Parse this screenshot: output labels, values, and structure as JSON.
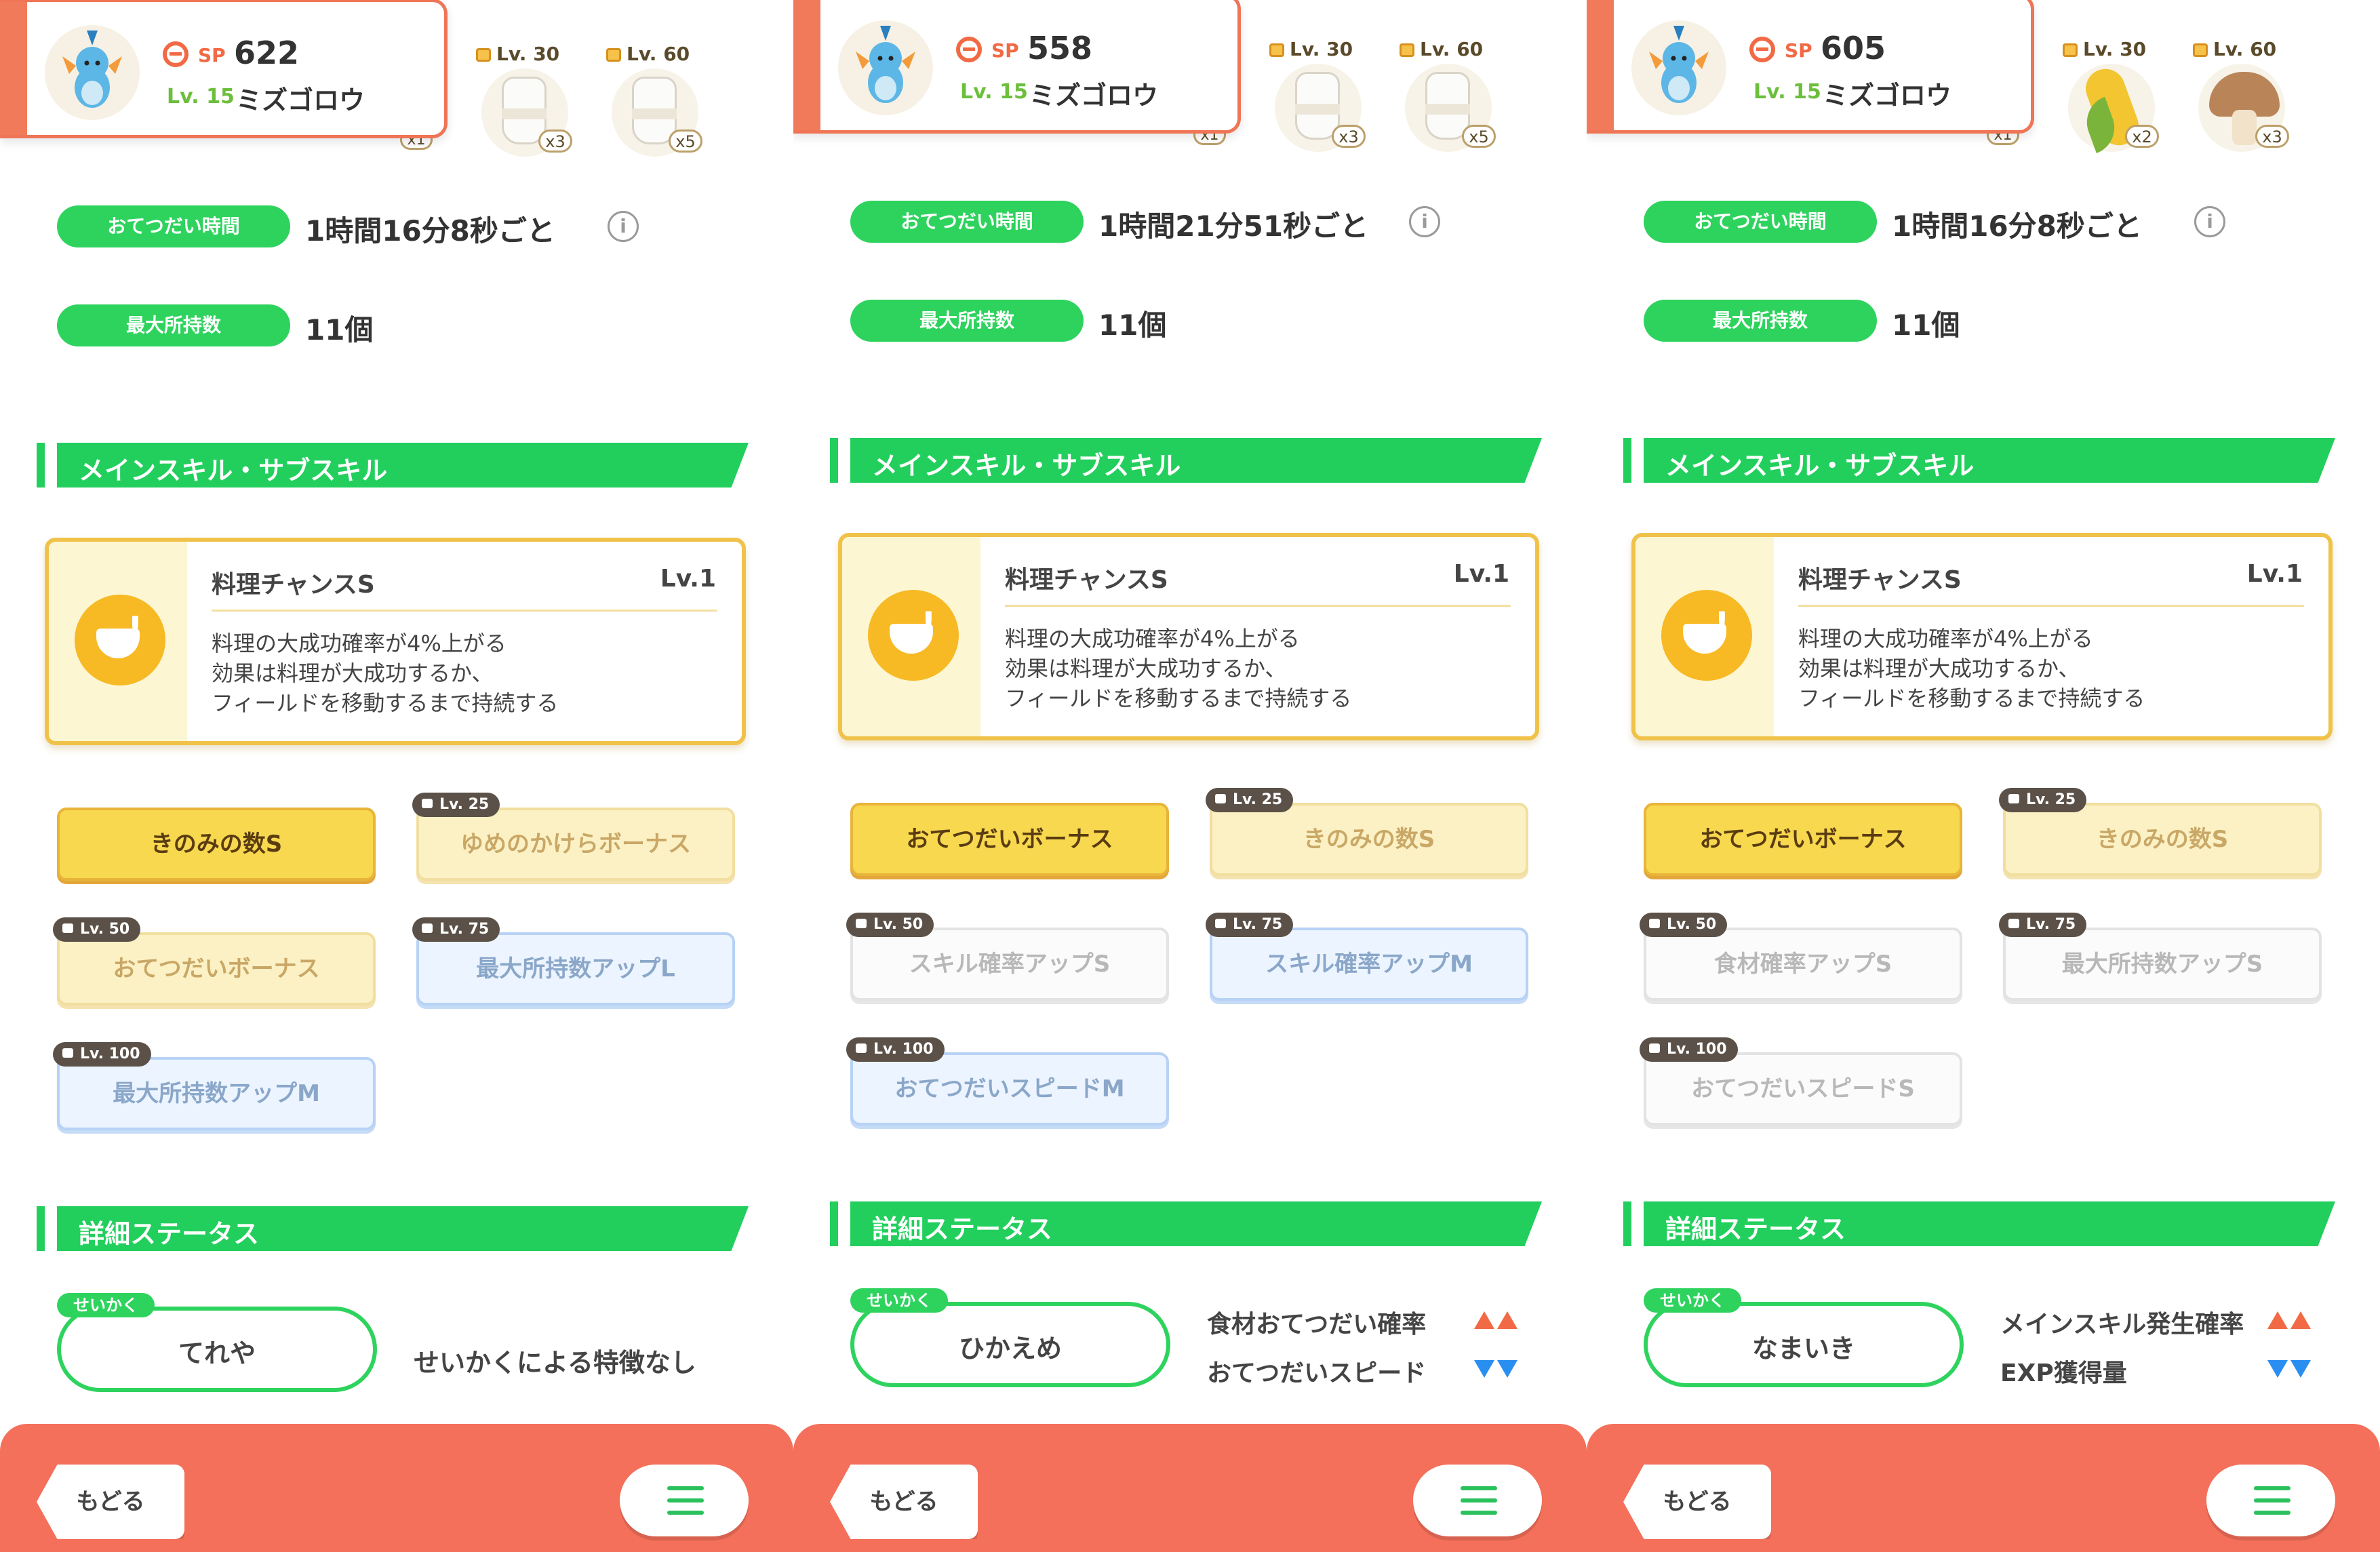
{
  "panels": [
    {
      "header": {
        "sp_label": "SP",
        "sp": "622",
        "level": "Lv. 15",
        "name": "ミズゴロウ",
        "ingredients": [
          {
            "lock": "Lv. 30",
            "count": "x3",
            "kind": "milk"
          },
          {
            "lock": "Lv. 60",
            "count": "x5",
            "kind": "milk"
          }
        ],
        "partial_count": "x1"
      },
      "help_label": "おてつだい時間",
      "help_value": "1時間16分8秒ごと",
      "max_label": "最大所持数",
      "max_value": "11個",
      "skills_section": "メインスキル・サブスキル",
      "main_skill": {
        "name": "料理チャンスS",
        "level": "Lv.1",
        "desc": "料理の大成功確率が4%上がる\n効果は料理が大成功するか、\nフィールドを移動するまで持続する"
      },
      "sub_skills": [
        {
          "label": "きのみの数S",
          "lock": "",
          "style": "gold"
        },
        {
          "label": "ゆめのかけらボーナス",
          "lock": "Lv. 25",
          "style": "gold-dim"
        },
        {
          "label": "おてつだいボーナス",
          "lock": "Lv. 50",
          "style": "gold-dim"
        },
        {
          "label": "最大所持数アップL",
          "lock": "Lv. 75",
          "style": "blue-dim"
        },
        {
          "label": "最大所持数アップM",
          "lock": "Lv. 100",
          "style": "blue-dim"
        }
      ],
      "details_section": "詳細ステータス",
      "nature_tag": "せいかく",
      "nature": "てれや",
      "nature_none": "せいかくによる特徴なし",
      "effects": [],
      "back": "もどる"
    },
    {
      "header": {
        "sp_label": "SP",
        "sp": "558",
        "level": "Lv. 15",
        "name": "ミズゴロウ",
        "ingredients": [
          {
            "lock": "Lv. 30",
            "count": "x3",
            "kind": "milk"
          },
          {
            "lock": "Lv. 60",
            "count": "x5",
            "kind": "milk"
          }
        ],
        "partial_count": "x1"
      },
      "help_label": "おてつだい時間",
      "help_value": "1時間21分51秒ごと",
      "max_label": "最大所持数",
      "max_value": "11個",
      "skills_section": "メインスキル・サブスキル",
      "main_skill": {
        "name": "料理チャンスS",
        "level": "Lv.1",
        "desc": "料理の大成功確率が4%上がる\n効果は料理が大成功するか、\nフィールドを移動するまで持続する"
      },
      "sub_skills": [
        {
          "label": "おてつだいボーナス",
          "lock": "",
          "style": "gold"
        },
        {
          "label": "きのみの数S",
          "lock": "Lv. 25",
          "style": "gold-dim"
        },
        {
          "label": "スキル確率アップS",
          "lock": "Lv. 50",
          "style": "white-dim"
        },
        {
          "label": "スキル確率アップM",
          "lock": "Lv. 75",
          "style": "blue-dim"
        },
        {
          "label": "おてつだいスピードM",
          "lock": "Lv. 100",
          "style": "blue-dim"
        }
      ],
      "details_section": "詳細ステータス",
      "nature_tag": "せいかく",
      "nature": "ひかえめ",
      "nature_none": "",
      "effects": [
        {
          "label": "食材おてつだい確率",
          "dir": "up"
        },
        {
          "label": "おてつだいスピード",
          "dir": "down"
        }
      ],
      "back": "もどる"
    },
    {
      "header": {
        "sp_label": "SP",
        "sp": "605",
        "level": "Lv. 15",
        "name": "ミズゴロウ",
        "ingredients": [
          {
            "lock": "Lv. 30",
            "count": "x2",
            "kind": "corn"
          },
          {
            "lock": "Lv. 60",
            "count": "x3",
            "kind": "mushroom"
          }
        ],
        "partial_count": "x1"
      },
      "help_label": "おてつだい時間",
      "help_value": "1時間16分8秒ごと",
      "max_label": "最大所持数",
      "max_value": "11個",
      "skills_section": "メインスキル・サブスキル",
      "main_skill": {
        "name": "料理チャンスS",
        "level": "Lv.1",
        "desc": "料理の大成功確率が4%上がる\n効果は料理が大成功するか、\nフィールドを移動するまで持続する"
      },
      "sub_skills": [
        {
          "label": "おてつだいボーナス",
          "lock": "",
          "style": "gold"
        },
        {
          "label": "きのみの数S",
          "lock": "Lv. 25",
          "style": "gold-dim"
        },
        {
          "label": "食材確率アップS",
          "lock": "Lv. 50",
          "style": "white-dim"
        },
        {
          "label": "最大所持数アップS",
          "lock": "Lv. 75",
          "style": "white-dim"
        },
        {
          "label": "おてつだいスピードS",
          "lock": "Lv. 100",
          "style": "white-dim"
        }
      ],
      "details_section": "詳細ステータス",
      "nature_tag": "せいかく",
      "nature": "なまいき",
      "nature_none": "",
      "effects": [
        {
          "label": "メインスキル発生確率",
          "dir": "up"
        },
        {
          "label": "EXP獲得量",
          "dir": "down"
        }
      ],
      "back": "もどる"
    }
  ]
}
